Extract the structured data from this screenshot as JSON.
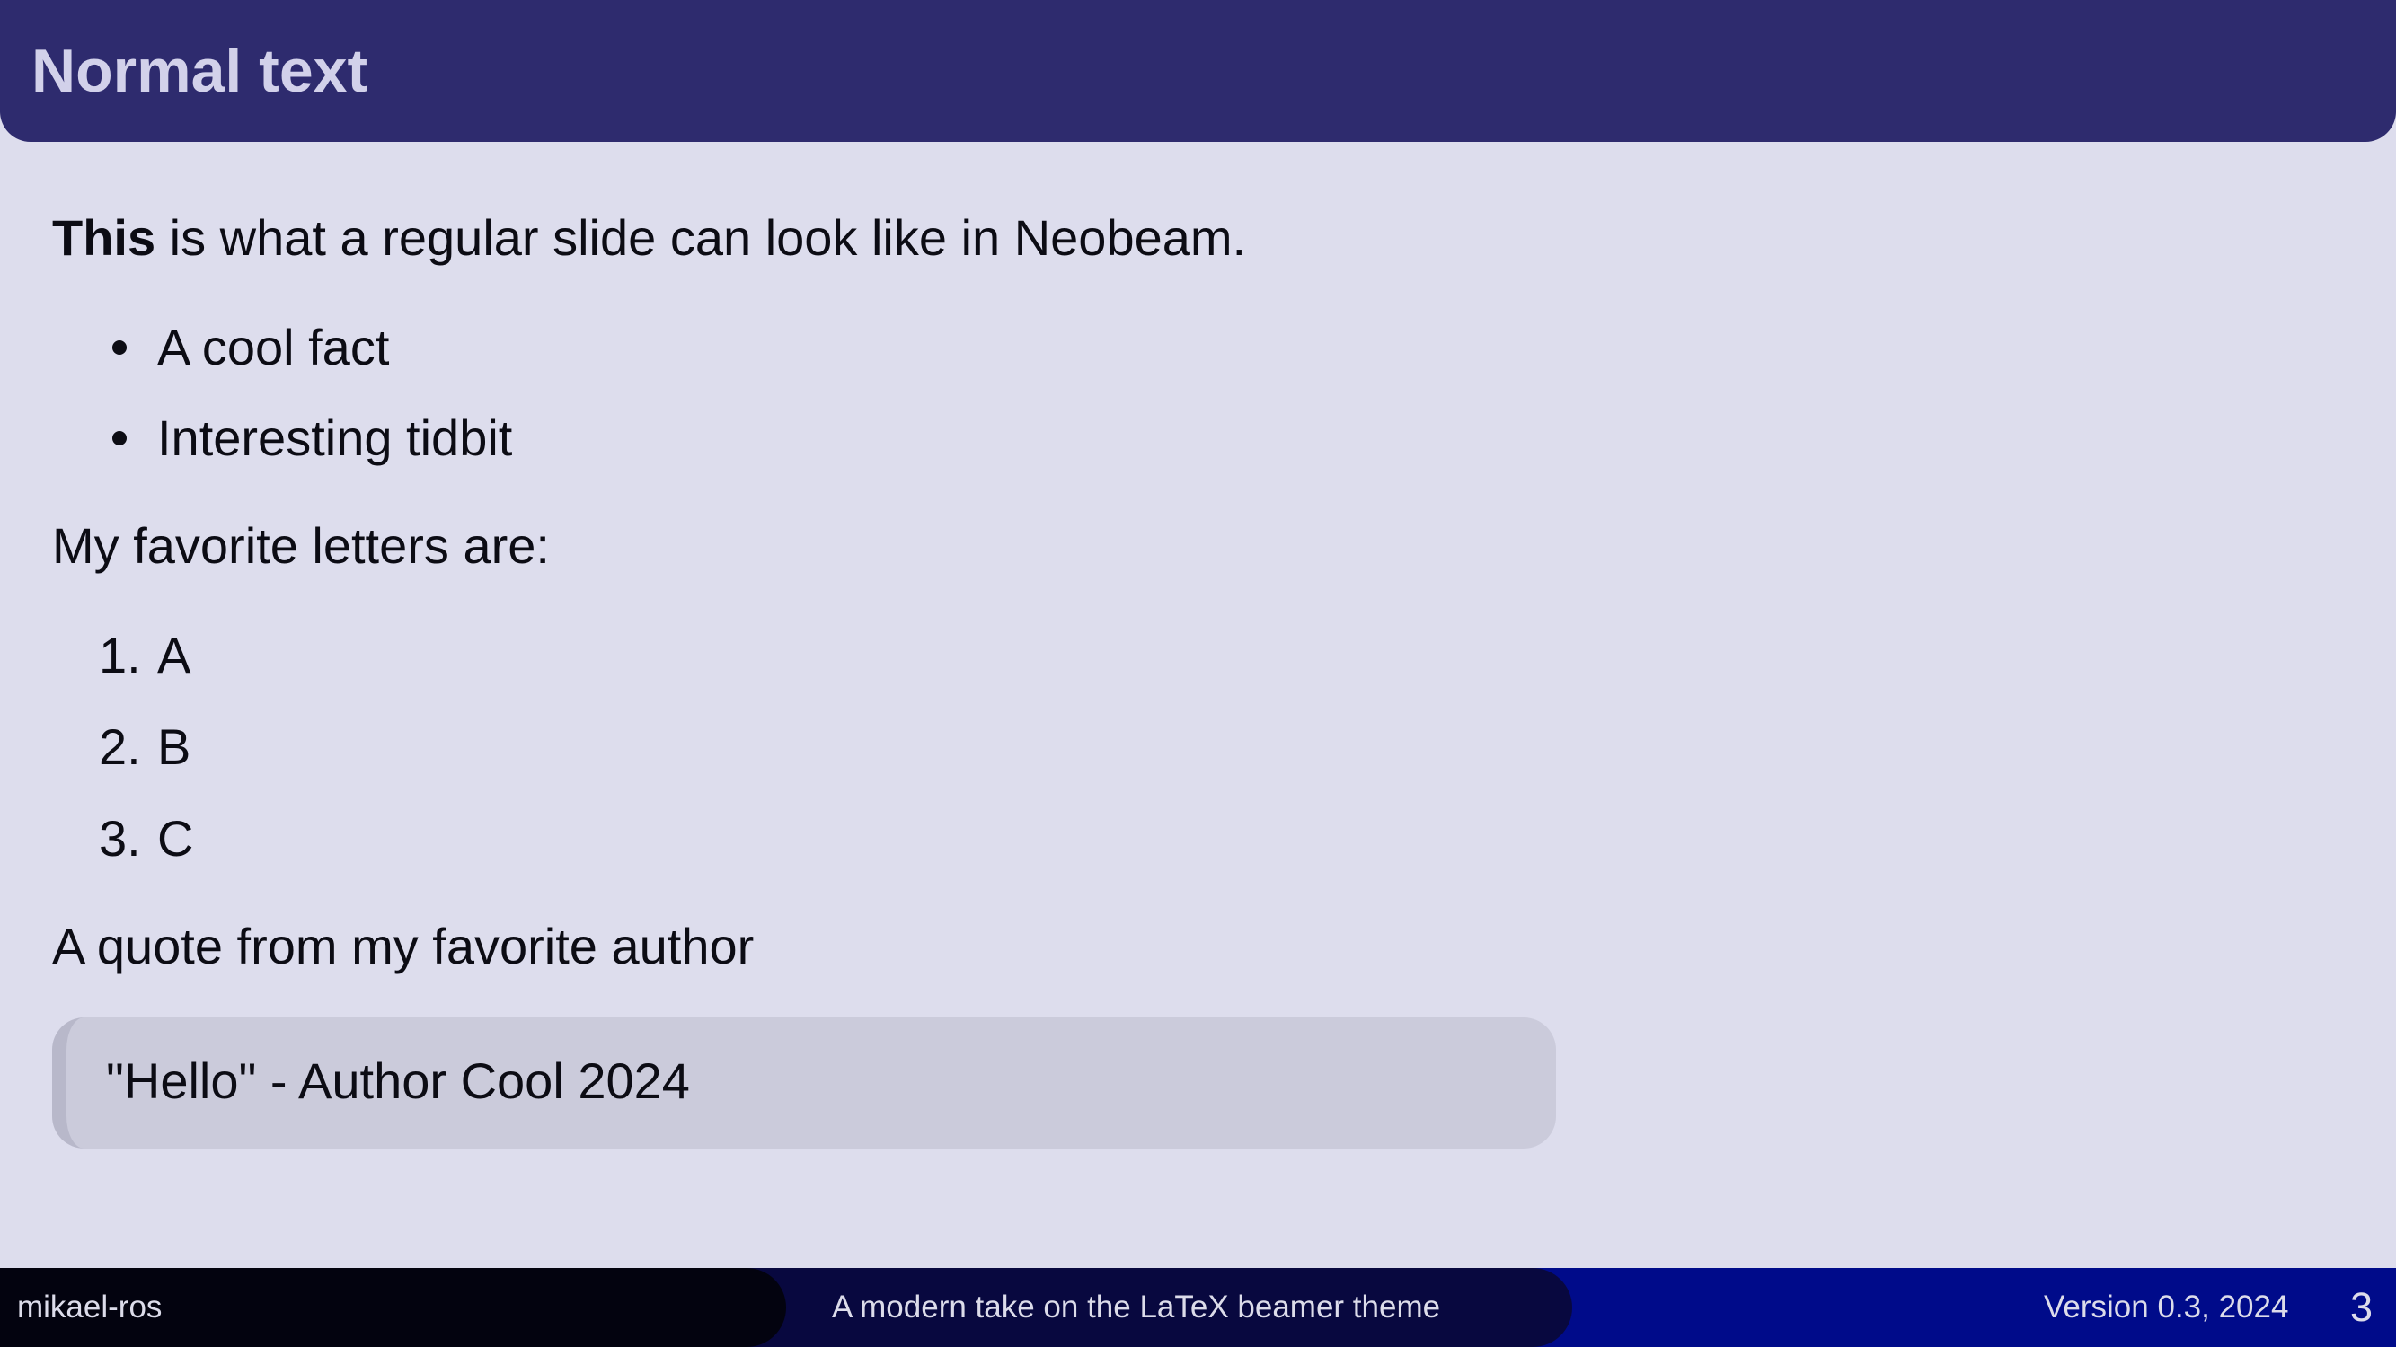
{
  "slide": {
    "title": "Normal text",
    "intro_bold": "This",
    "intro_rest": " is what a regular slide can look like in Neobeam.",
    "bullets": [
      "A cool fact",
      "Interesting tidbit"
    ],
    "letters_heading": "My favorite letters are:",
    "enumerated": [
      {
        "number": "1.",
        "label": "A"
      },
      {
        "number": "2.",
        "label": "B"
      },
      {
        "number": "3.",
        "label": "C"
      }
    ],
    "quote_heading": "A quote from my favorite author",
    "quote": "\"Hello\" - Author Cool 2024"
  },
  "footer": {
    "author": "mikael-ros",
    "subtitle": "A modern take on the LaTeX beamer theme",
    "date": "Version 0.3, 2024",
    "page_number": "3"
  },
  "colors": {
    "title_bar": "#2e2b6e",
    "title_text": "#d2d1ea",
    "background": "#dddded",
    "quote_box": "#cbcbdb",
    "footer_left": "#03030f",
    "footer_mid": "#08083f",
    "footer_right": "#000b8a"
  }
}
